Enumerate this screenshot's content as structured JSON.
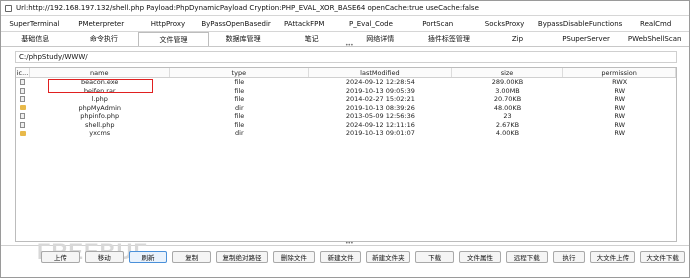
{
  "window": {
    "title": "Url:http://192.168.197.132/shell.php Payload:PhpDynamicPayload Cryption:PHP_EVAL_XOR_BASE64 openCache:true useCache:false"
  },
  "tabs_row1": [
    "SuperTerminal",
    "PMeterpreter",
    "HttpProxy",
    "ByPassOpenBasedir",
    "PAttackFPM",
    "P_Eval_Code",
    "PortScan",
    "SocksProxy",
    "BypassDisableFunctions",
    "RealCmd"
  ],
  "tabs_row2": [
    "基础信息",
    "命令执行",
    "文件管理",
    "数据库管理",
    "笔记",
    "网络详情",
    "插件标签管理",
    "Zip",
    "PSuperServer",
    "PWebShellScan"
  ],
  "active_tab": "文件管理",
  "path": "C:/phpStudy/WWW/",
  "table": {
    "headers": [
      "ic...",
      "name",
      "type",
      "lastModified",
      "size",
      "permission"
    ],
    "rows": [
      {
        "icon": "file-icon",
        "name": "beacon.exe",
        "type": "file",
        "lastModified": "2024-09-12 12:28:54",
        "size": "289.00KB",
        "permission": "RWX"
      },
      {
        "icon": "file-icon",
        "name": "beifen.rar",
        "type": "file",
        "lastModified": "2019-10-13 09:05:39",
        "size": "3.00MB",
        "permission": "RW"
      },
      {
        "icon": "file-icon",
        "name": "l.php",
        "type": "file",
        "lastModified": "2014-02-27 15:02:21",
        "size": "20.70KB",
        "permission": "RW"
      },
      {
        "icon": "folder-icon",
        "name": "phpMyAdmin",
        "type": "dir",
        "lastModified": "2019-10-13 08:39:26",
        "size": "48.00KB",
        "permission": "RW"
      },
      {
        "icon": "file-icon",
        "name": "phpinfo.php",
        "type": "file",
        "lastModified": "2013-05-09 12:56:36",
        "size": "23",
        "permission": "RW"
      },
      {
        "icon": "file-icon",
        "name": "shell.php",
        "type": "file",
        "lastModified": "2024-09-12 12:11:16",
        "size": "2.67KB",
        "permission": "RW"
      },
      {
        "icon": "folder-icon",
        "name": "yxcms",
        "type": "dir",
        "lastModified": "2019-10-13 09:01:07",
        "size": "4.00KB",
        "permission": "RW"
      }
    ]
  },
  "buttons": [
    "上传",
    "移动",
    "刷新",
    "复制",
    "复制绝对路径",
    "删除文件",
    "新建文件",
    "新建文件夹",
    "下载",
    "文件属性",
    "远程下载",
    "执行",
    "大文件上传",
    "大文件下载"
  ],
  "focused_button": "刷新",
  "watermark": "FREEBUF",
  "colors": {
    "highlight_box": "#e02020",
    "folder": "#e8b94a",
    "focus": "#4a90d9"
  }
}
